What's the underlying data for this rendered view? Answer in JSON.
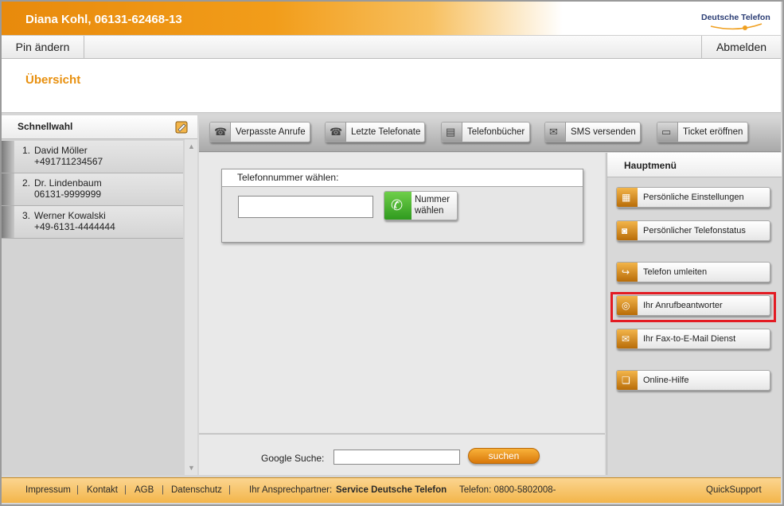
{
  "header": {
    "title": "Diana Kohl, 06131-62468-13",
    "logo_text": "Deutsche Telefon"
  },
  "topnav": {
    "pin": "Pin ändern",
    "logout": "Abmelden"
  },
  "overview": {
    "title": "Übersicht"
  },
  "speed_dial": {
    "title": "Schnellwahl",
    "entries": [
      {
        "num": "1.",
        "name": "David Möller",
        "phone": "+491711234567"
      },
      {
        "num": "2.",
        "name": "Dr. Lindenbaum",
        "phone": "06131-9999999"
      },
      {
        "num": "3.",
        "name": "Werner Kowalski",
        "phone": "+49-6131-4444444"
      }
    ]
  },
  "toolbar": {
    "missed": "Verpasste Anrufe",
    "recent": "Letzte Telefonate",
    "phonebooks": "Telefonbücher",
    "sms": "SMS versenden",
    "ticket": "Ticket eröffnen"
  },
  "dial": {
    "label": "Telefonnummer wählen:",
    "value": "",
    "button_line1": "Nummer",
    "button_line2": "wählen"
  },
  "search": {
    "label": "Google Suche:",
    "value": "",
    "button": "suchen"
  },
  "main_menu": {
    "title": "Hauptmenü",
    "items": [
      {
        "label": "Persönliche Einstellungen"
      },
      {
        "label": "Persönlicher Telefonstatus"
      },
      {
        "label": "Telefon umleiten"
      },
      {
        "label": "Ihr Anrufbeantworter"
      },
      {
        "label": "Ihr Fax-to-E-Mail Dienst"
      },
      {
        "label": "Online-Hilfe"
      }
    ],
    "highlighted_item": "Ihr Anrufbeantworter",
    "highlight_color": "#e31b23"
  },
  "footer": {
    "impressum": "Impressum",
    "kontakt": "Kontakt",
    "agb": "AGB",
    "datenschutz": "Datenschutz",
    "partner_label": "Ihr Ansprechpartner:",
    "partner_name": "Service Deutsche Telefon",
    "phone": "Telefon: 0800-5802008-",
    "quicksupport": "QuickSupport",
    "separator": "|"
  },
  "colors": {
    "accent": "#e8900f",
    "footer": "#f3b54a"
  }
}
